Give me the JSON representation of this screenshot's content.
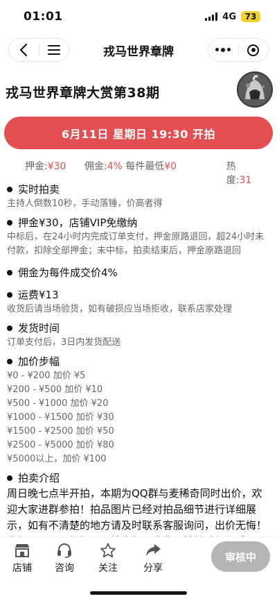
{
  "status_bar": {
    "time": "01:01",
    "network": "4G",
    "battery": "73"
  },
  "nav": {
    "title": "戎马世界章牌"
  },
  "page": {
    "title": "戎马世界章牌大赏第38期",
    "time_button": "6月11日 星期日 19:30 开拍"
  },
  "stats": {
    "deposit_label": "押金:",
    "deposit_value": "¥30",
    "commission_label": "佣金:",
    "commission_value": "4%",
    "min_label": " 每件最低",
    "min_value": "¥0",
    "heat_label": "热度:",
    "heat_value": "31"
  },
  "sections": {
    "live": {
      "title": "实时拍卖",
      "body": "主持人倒数10秒，手动落锤，价高者得"
    },
    "deposit": {
      "title": "押金¥30，店铺VIP免缴纳",
      "body": "中标后，在24小时内完成订单支付，押金原路退回，超24小时未付款，扣除全部押金；未中标，拍卖结束后，押金原路退回"
    },
    "commission": {
      "title": "佣金为每件成交价4%"
    },
    "shipping_fee": {
      "title": "运费¥13",
      "body": "收货后请当场验货，如有破损应当场拒收，联系店家处理"
    },
    "delivery": {
      "title": "发货时间",
      "body": "订单支付后，3日内发货配送"
    },
    "increment": {
      "title": "加价步幅",
      "steps": [
        "¥0 - ¥200 加价 ¥5",
        "¥200 - ¥500 加价 ¥10",
        "¥500 - ¥1000 加价 ¥20",
        "¥1000 - ¥1500 加价 ¥30",
        "¥1500 - ¥2500 加价 ¥50",
        "¥2500 - ¥5000 加价 ¥80",
        "¥5000以上，加价 ¥100"
      ]
    },
    "intro": {
      "title": "拍卖介绍",
      "body": "周日晚七点半开拍，本期为QQ群与麦稀奇同时出价，欢迎大家进群参拍！拍品图片已经对拍品细节进行详细展示，如有不清楚的地方请及时联系客服询问，出价无悔！非假不退！品相如图！拍中如图发货！拍前请仔细看图！如有不清楚请及时联系客服询"
    }
  },
  "bottom": {
    "tabs": [
      "店铺",
      "咨询",
      "关注",
      "分享"
    ],
    "review_button": "审核中"
  },
  "colors": {
    "accent": "#e24e52",
    "battery": "#f2d22a",
    "disabled": "#b5b5b5"
  }
}
